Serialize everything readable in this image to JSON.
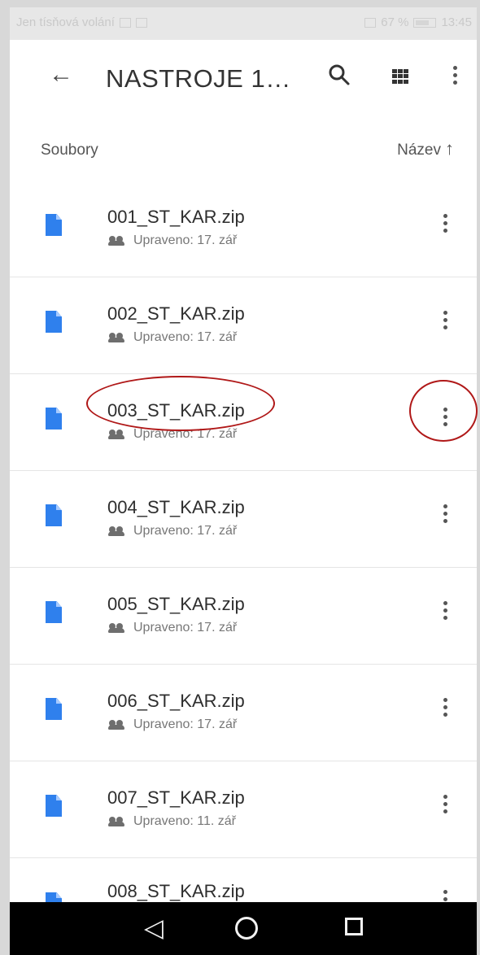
{
  "status_bar": {
    "left_text": "Jen tísňová volání",
    "right_text": "67 %",
    "time": "13:45"
  },
  "app_bar": {
    "title": "NASTROJE 1…",
    "back_icon": "arrow-left",
    "actions": [
      "search-icon",
      "grid-view-icon",
      "more-vert-icon"
    ]
  },
  "list_header": {
    "left": "Soubory",
    "sort_label": "Název",
    "sort_arrow": "↑"
  },
  "files": [
    {
      "name": "001_ST_KAR.zip",
      "meta": "Upraveno: 17. zář"
    },
    {
      "name": "002_ST_KAR.zip",
      "meta": "Upraveno: 17. zář"
    },
    {
      "name": "003_ST_KAR.zip",
      "meta": "Upraveno: 17. zář"
    },
    {
      "name": "004_ST_KAR.zip",
      "meta": "Upraveno: 17. zář"
    },
    {
      "name": "005_ST_KAR.zip",
      "meta": "Upraveno: 17. zář"
    },
    {
      "name": "006_ST_KAR.zip",
      "meta": "Upraveno: 17. zář"
    },
    {
      "name": "007_ST_KAR.zip",
      "meta": "Upraveno: 11. zář"
    },
    {
      "name": "008_ST_KAR.zip",
      "meta": ""
    }
  ],
  "nav_bar": {
    "back": "◁",
    "home": "○",
    "recents": "□"
  },
  "colors": {
    "file_icon": "#2f80ed",
    "annotation": "#b01818"
  }
}
